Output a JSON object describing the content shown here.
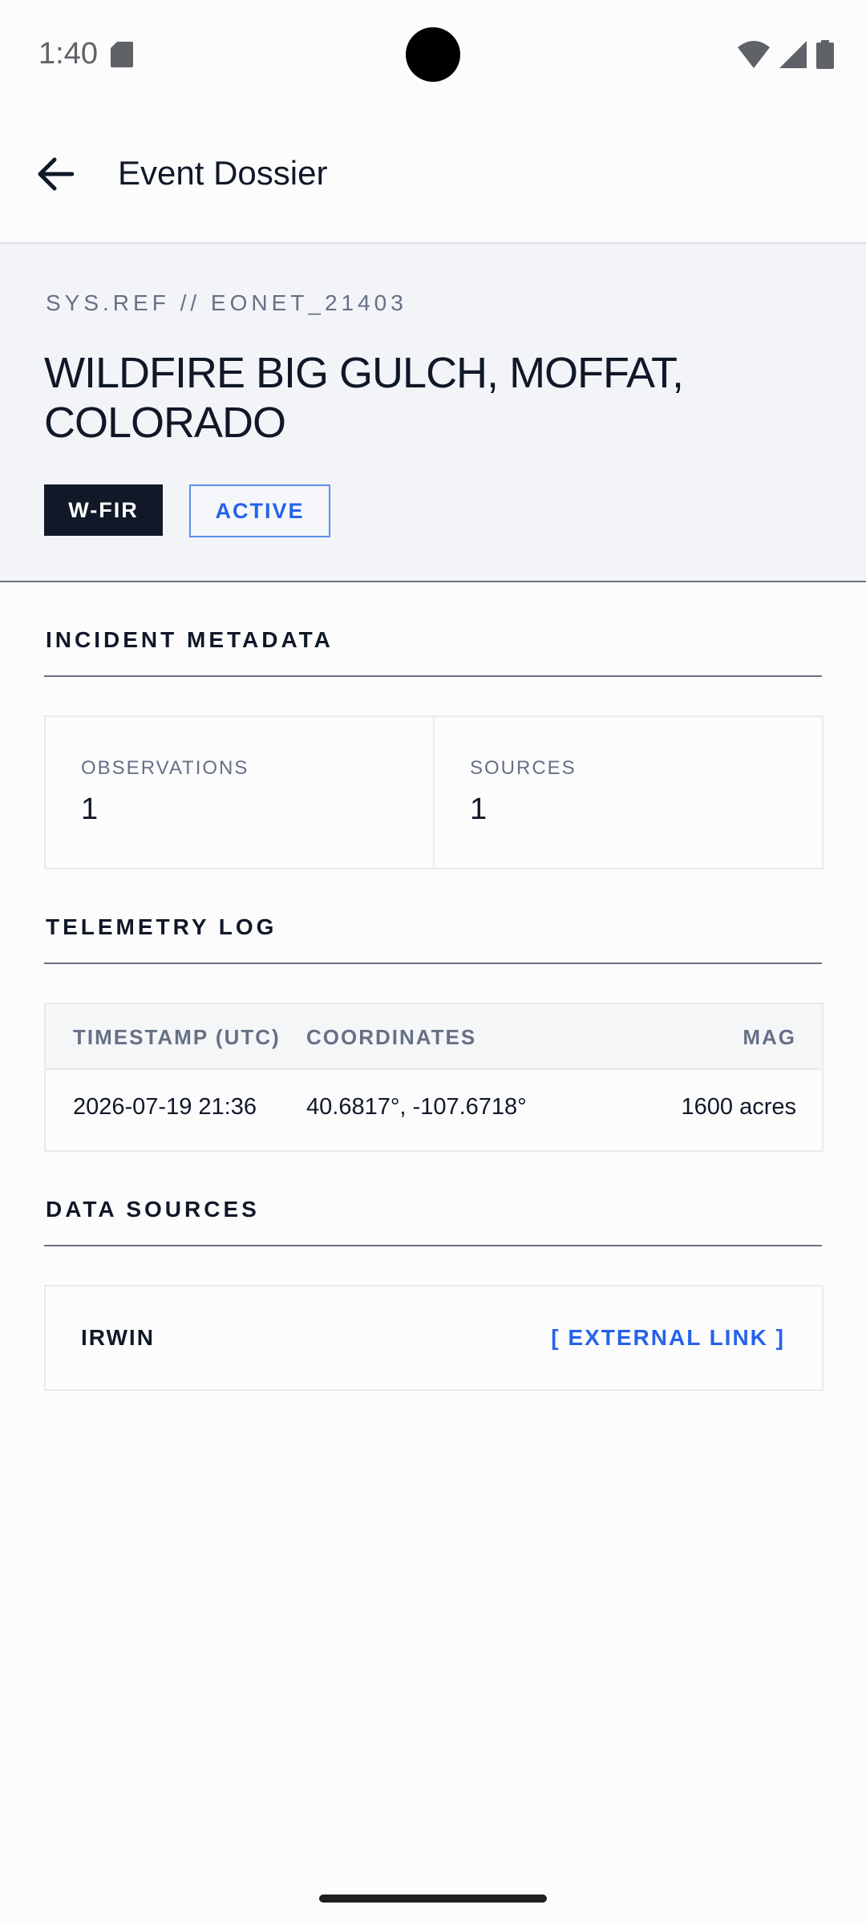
{
  "status_bar": {
    "time": "1:40",
    "icons": [
      "sd-card-icon",
      "wifi-icon",
      "cellular-signal-icon",
      "battery-icon"
    ]
  },
  "app_bar": {
    "title": "Event Dossier",
    "back_icon": "arrow-back-icon"
  },
  "hero": {
    "sys_ref": "SYS.REF // EONET_21403",
    "title": "WILDFIRE BIG GULCH, MOFFAT, COLORADO",
    "category_tag": "W-FIR",
    "status_tag": "ACTIVE"
  },
  "incident_metadata": {
    "heading": "INCIDENT METADATA",
    "stats": [
      {
        "label": "OBSERVATIONS",
        "value": "1"
      },
      {
        "label": "SOURCES",
        "value": "1"
      }
    ]
  },
  "telemetry_log": {
    "heading": "TELEMETRY LOG",
    "columns": [
      "TIMESTAMP (UTC)",
      "COORDINATES",
      "MAG"
    ],
    "rows": [
      {
        "timestamp": "2026-07-19 21:36",
        "coordinates": "40.6817°, -107.6718°",
        "mag": "1600 acres"
      }
    ]
  },
  "data_sources": {
    "heading": "DATA SOURCES",
    "items": [
      {
        "name": "IRWIN",
        "link_label": "[ EXTERNAL LINK ]"
      }
    ]
  },
  "colors": {
    "accent": "#2563eb",
    "dark": "#111827",
    "hero_bg": "#f2f4f7",
    "muted_text": "#667085"
  }
}
